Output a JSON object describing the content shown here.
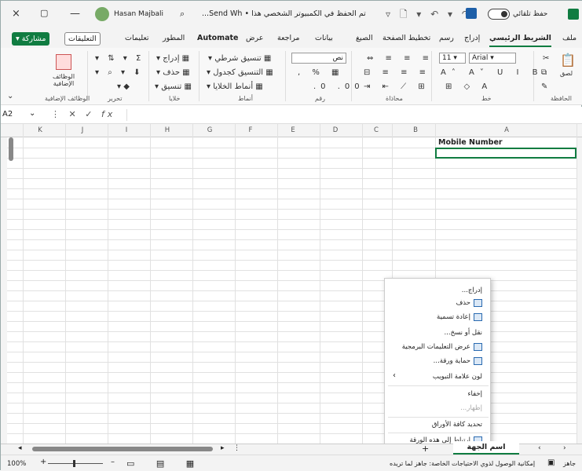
{
  "titlebar": {
    "close": "×",
    "restore": "▢",
    "minimize": "—",
    "user_name": "Hasan Majbali",
    "doc_title": "تم الحفظ في الكمبيوتر الشخصي هذا • Send Wh...",
    "autosave_label": "حفظ تلقائي",
    "quick_access": "▿ 🗋 ▾ ↶ ▾ ↷"
  },
  "tabs": [
    {
      "label": "ملف"
    },
    {
      "label": "الشريط الرئيسي",
      "active": true
    },
    {
      "label": "إدراج"
    },
    {
      "label": "رسم"
    },
    {
      "label": "تخطيط الصفحة"
    },
    {
      "label": "الصيغ"
    },
    {
      "label": "بيانات"
    },
    {
      "label": "مراجعة"
    },
    {
      "label": "عرض"
    },
    {
      "label": "Automate"
    },
    {
      "label": "المطور"
    },
    {
      "label": "تعليمات"
    }
  ],
  "share_label": "مشاركة",
  "comments_label": "التعليقات",
  "ribbon": {
    "groups": [
      "الحافظة",
      "خط",
      "محاذاة",
      "رقم",
      "أنماط",
      "خلايا",
      "تحرير",
      "الوظائف الإضافية"
    ],
    "paste": "لصق",
    "font_name": "Arial",
    "font_size": "11",
    "number_format": "نص",
    "conditional": "تنسيق شرطي",
    "format_table": "التنسيق كجدول",
    "cell_styles": "أنماط الخلايا",
    "insert": "إدراج",
    "delete": "حذف",
    "format": "تنسيق",
    "addins": "الوظائف الإضافية"
  },
  "formula_bar": {
    "name_box": "A2",
    "fx": "fx"
  },
  "columns": [
    "K",
    "J",
    "I",
    "H",
    "G",
    "F",
    "E",
    "D",
    "C",
    "B",
    "A"
  ],
  "cells": {
    "A1": "Mobile Number"
  },
  "context_menu": {
    "items": [
      {
        "label": "إدراج...",
        "disabled": false
      },
      {
        "label": "حذف",
        "disabled": false
      },
      {
        "label": "إعادة تسمية",
        "disabled": false
      },
      {
        "label": "نقل أو نسخ...",
        "disabled": false
      },
      {
        "label": "عرض التعليمات البرمجية",
        "disabled": false
      },
      {
        "label": "حماية ورقة...",
        "disabled": false
      },
      {
        "label": "لون علامة التبويب",
        "disabled": false
      },
      {
        "label": "إخفاء",
        "disabled": false
      },
      {
        "label": "إظهار...",
        "disabled": true
      },
      {
        "label": "تحديد كافة الأوراق",
        "disabled": false
      },
      {
        "label": "ارتباط إلى هذه الورقة",
        "disabled": false
      }
    ]
  },
  "sheet_tab": "اسم الجهة الداخلية",
  "status": {
    "zoom": "100%",
    "accessibility": "إمكانية الوصول لذوي الاحتياجات الخاصة: جاهز لما تريده",
    "ready": "جاهز"
  },
  "colors": {
    "accent": "#107c41"
  }
}
